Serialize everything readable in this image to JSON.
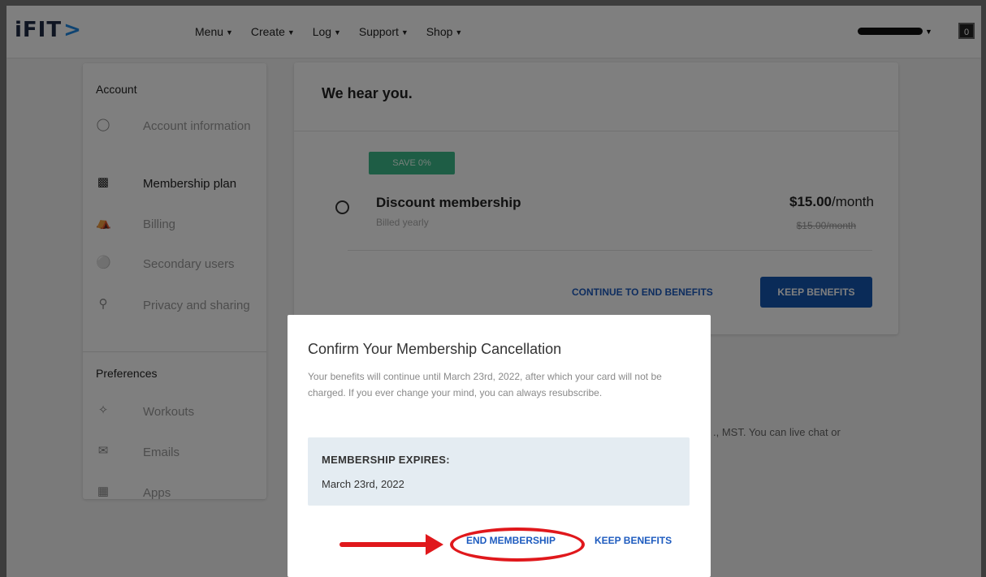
{
  "header": {
    "logo_text": "iFIT",
    "logo_mark": ">",
    "nav": [
      {
        "label": "Menu"
      },
      {
        "label": "Create"
      },
      {
        "label": "Log"
      },
      {
        "label": "Support"
      },
      {
        "label": "Shop"
      }
    ],
    "cart_count": "0"
  },
  "sidebar": {
    "account_heading": "Account",
    "account_items": [
      {
        "label": "Account information",
        "icon": "user-icon"
      },
      {
        "label": "Membership plan",
        "icon": "id-card-icon"
      },
      {
        "label": "Billing",
        "icon": "cart-icon"
      },
      {
        "label": "Secondary users",
        "icon": "add-user-icon"
      },
      {
        "label": "Privacy and sharing",
        "icon": "user-lock-icon"
      }
    ],
    "preferences_heading": "Preferences",
    "preference_items": [
      {
        "label": "Workouts",
        "icon": "dumbbell-icon"
      },
      {
        "label": "Emails",
        "icon": "envelope-icon"
      },
      {
        "label": "Apps",
        "icon": "grid-icon"
      }
    ]
  },
  "main": {
    "title": "We hear you.",
    "badge": "SAVE 0%",
    "plan_name": "Discount membership",
    "plan_billing": "Billed yearly",
    "price": "$15.00",
    "price_unit": "/month",
    "price_old": "$15.00/month",
    "continue_label": "CONTINUE TO END BENEFITS",
    "keep_label": "KEEP BENEFITS",
    "background_text": "., MST. You can live chat or"
  },
  "modal": {
    "title": "Confirm Your Membership Cancellation",
    "body": "Your benefits will continue until March 23rd, 2022, after which your card will not be charged. If you ever change your mind, you can always resubscribe.",
    "expires_label": "MEMBERSHIP EXPIRES:",
    "expires_date": "March 23rd, 2022",
    "end_label": "END MEMBERSHIP",
    "keep_label": "KEEP BENEFITS"
  },
  "colors": {
    "accent": "#1557b0",
    "badge": "#3dbb8a",
    "annotation": "#e0181c"
  }
}
